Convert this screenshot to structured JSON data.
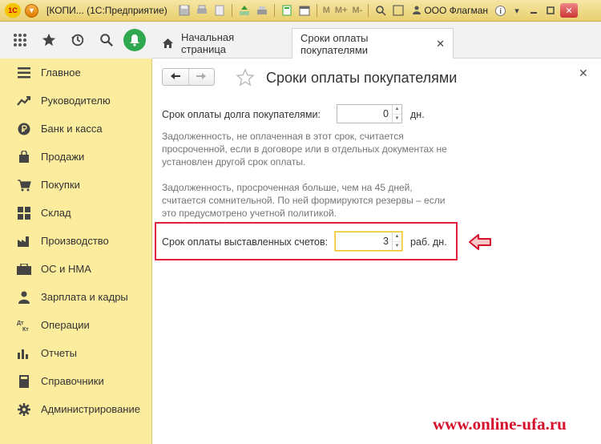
{
  "titlebar": {
    "logo": "1С",
    "title": "[КОПИ... (1С:Предприятие)",
    "m_labels": [
      "M",
      "M+",
      "M-"
    ],
    "org": "ООО Флагман"
  },
  "tabs": {
    "home": "Начальная страница",
    "active": "Сроки оплаты покупателями"
  },
  "sidebar": {
    "items": [
      {
        "label": "Главное",
        "icon": "list-icon"
      },
      {
        "label": "Руководителю",
        "icon": "trend-icon"
      },
      {
        "label": "Банк и касса",
        "icon": "ruble-coin-icon"
      },
      {
        "label": "Продажи",
        "icon": "shopping-bag-icon"
      },
      {
        "label": "Покупки",
        "icon": "cart-icon"
      },
      {
        "label": "Склад",
        "icon": "warehouse-grid-icon"
      },
      {
        "label": "Производство",
        "icon": "factory-icon"
      },
      {
        "label": "ОС и НМА",
        "icon": "os-box-icon"
      },
      {
        "label": "Зарплата и кадры",
        "icon": "person-icon"
      },
      {
        "label": "Операции",
        "icon": "dt-kt-icon"
      },
      {
        "label": "Отчеты",
        "icon": "bar-chart-icon"
      },
      {
        "label": "Справочники",
        "icon": "book-icon"
      },
      {
        "label": "Администрирование",
        "icon": "gear-icon"
      }
    ]
  },
  "form": {
    "title": "Сроки оплаты покупателями",
    "debt_term_label": "Срок оплаты долга покупателями:",
    "debt_term_value": "0",
    "debt_term_unit": "дн.",
    "note1": [
      "Задолженность, не оплаченная в этот срок, считается",
      "просроченной, если в договоре или в отдельных документах не",
      "установлен другой срок оплаты."
    ],
    "note2": [
      "Задолженность, просроченная больше, чем на 45 дней,",
      "считается сомнительной. По ней формируются резервы – если",
      "это предусмотрено учетной политикой."
    ],
    "invoice_term_label": "Срок оплаты выставленных счетов:",
    "invoice_term_value": "3",
    "invoice_term_unit": "раб. дн."
  },
  "watermark": "www.online-ufa.ru",
  "colors": {
    "sidebar_bg": "#fbec9e",
    "highlight": "#e0223a",
    "accent_green": "#2fa84f",
    "watermark": "#d4102c"
  }
}
